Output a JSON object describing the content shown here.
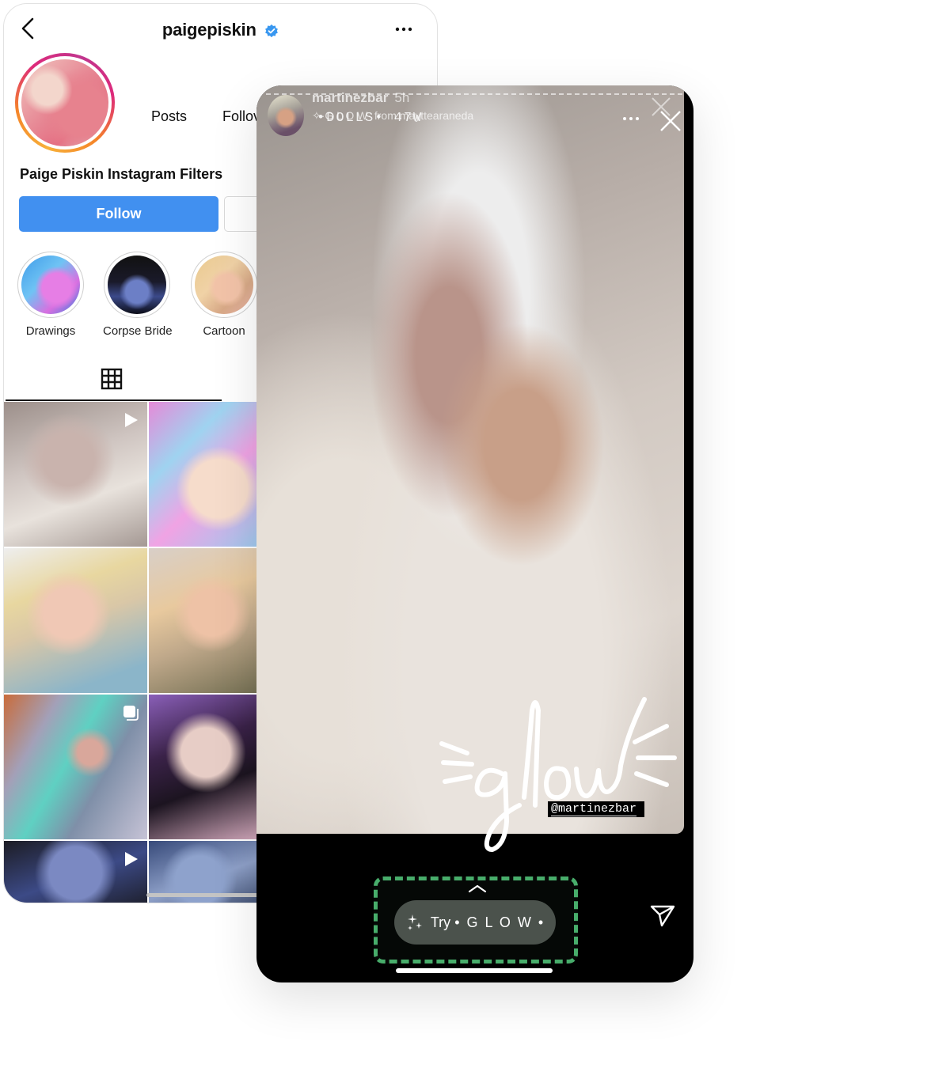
{
  "profile": {
    "username": "paigepiskin",
    "verified": true,
    "stats": {
      "posts_label": "Posts",
      "followers_label": "Follov"
    },
    "bio_name": "Paige Piskin Instagram Filters",
    "follow_label": "Follow",
    "highlights": [
      {
        "label": "Drawings"
      },
      {
        "label": "Corpse Bride"
      },
      {
        "label": "Cartoon"
      }
    ],
    "grid_tab": "grid-icon",
    "posts": [
      {
        "type": "video",
        "badge": "play-icon"
      },
      {
        "type": "image",
        "badge": ""
      },
      {
        "type": "image",
        "badge": ""
      },
      {
        "type": "image",
        "badge": ""
      },
      {
        "type": "carousel",
        "badge": "carousel-icon"
      },
      {
        "type": "image",
        "badge": ""
      },
      {
        "type": "video",
        "badge": "play-icon"
      },
      {
        "type": "image",
        "badge": ""
      }
    ]
  },
  "story": {
    "username": "martinezbar",
    "time": "5h",
    "effect_line": "✧ • G L O W • from maytttearaneda",
    "effect_credit": "✧·G L O W· from mayttearaneda",
    "ghost_overlay": "•DOLLS• 47W",
    "sticker_text": "glow",
    "mention": "@martinezbar",
    "try_prefix": "Try",
    "try_effect": "• G L O W •",
    "highlight_color": "#48ad6b"
  },
  "colors": {
    "follow_blue": "#4190f0",
    "verified_blue": "#3897f0",
    "story_bg": "#000000",
    "pill_bg": "#4b524c"
  }
}
